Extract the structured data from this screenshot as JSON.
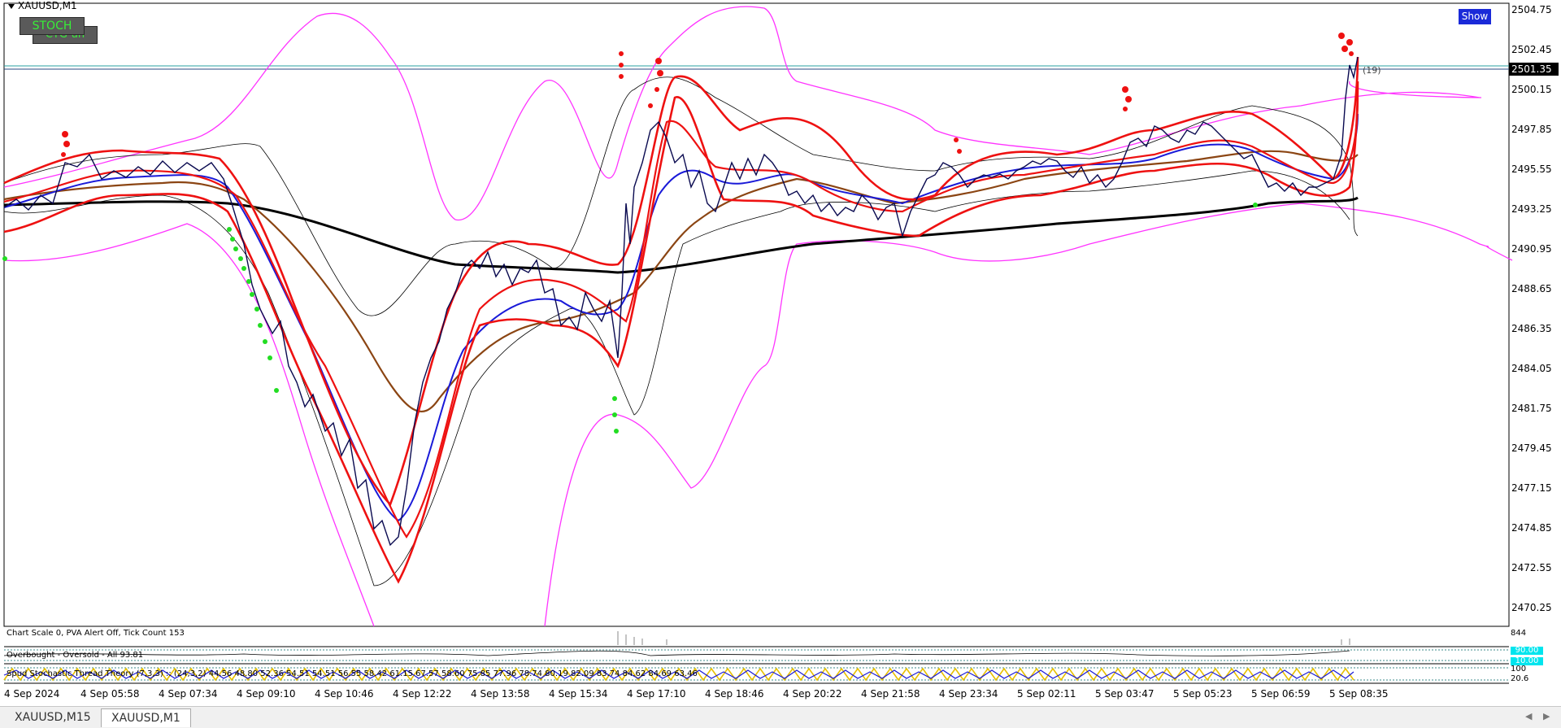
{
  "window": {
    "symbol_title": "XAUUSD,M1"
  },
  "buttons": {
    "stoch": "STOCH",
    "ctg": "CTG-un",
    "show": "Show"
  },
  "price_axis": {
    "labels": [
      "2504.75",
      "2502.45",
      "2500.15",
      "2497.85",
      "2495.55",
      "2493.25",
      "2490.95",
      "2488.65",
      "2486.35",
      "2484.05",
      "2481.75",
      "2479.45",
      "2477.15",
      "2474.85",
      "2472.55",
      "2470.25"
    ],
    "current_price": "2501.35",
    "order_count": "(19)"
  },
  "indicators": {
    "volume_info": "Chart Scale  0,  PVA Alert Off,  Tick Count  153",
    "volume_axis_max": "844",
    "overbought_info": "Overbought - Oversold - All 93.81",
    "stoch_info": "Spud Stochastic Thread Theory (7,3,3) :: (24,3,2) 44.56 48.80 52.36 54.51 54.51 56.55 58.42 61.15 67.57 58.60 75.85 77.96 78.74 80.19 82.09 83.74 84.62 84.69 63.46",
    "level_high": "90.00",
    "level_low": "10.00",
    "stoch_axis_top": "100",
    "stoch_axis_bottom": "20.6"
  },
  "time_axis": {
    "labels": [
      "4 Sep 2024",
      "4 Sep 05:58",
      "4 Sep 07:34",
      "4 Sep 09:10",
      "4 Sep 10:46",
      "4 Sep 12:22",
      "4 Sep 13:58",
      "4 Sep 15:34",
      "4 Sep 17:10",
      "4 Sep 18:46",
      "4 Sep 20:22",
      "4 Sep 21:58",
      "4 Sep 23:34",
      "5 Sep 02:11",
      "5 Sep 03:47",
      "5 Sep 05:23",
      "5 Sep 06:59",
      "5 Sep 08:35"
    ]
  },
  "tabs": [
    {
      "label": "XAUUSD,M15",
      "active": false
    },
    {
      "label": "XAUUSD,M1",
      "active": true
    }
  ],
  "colors": {
    "candles": "#0a0a50",
    "bands_outer": "#ff33ff",
    "bands_red": "#ee1111",
    "ma_brown": "#8b4513",
    "ma_black": "#000000",
    "ma_blue": "#1a1ad8",
    "buy_arrow": "#22dd22",
    "sell_arrow": "#ee1111"
  }
}
